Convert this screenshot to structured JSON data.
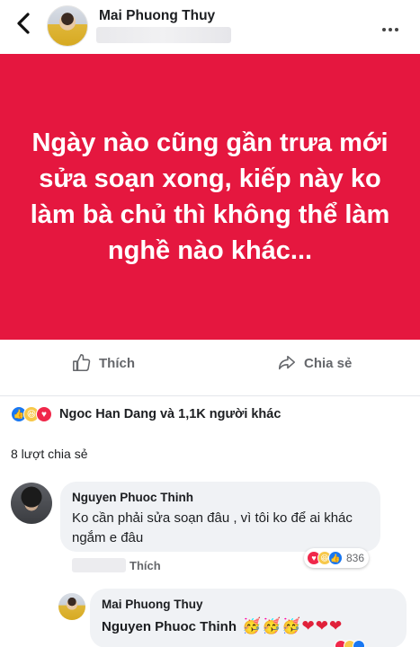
{
  "header": {
    "back_icon": "chevron-left-icon",
    "name": "Mai Phuong Thuy",
    "more_icon": "more-horizontal-icon"
  },
  "post": {
    "text": "Ngày nào cũng gần trưa mới sửa soạn xong, kiếp này ko làm bà chủ thì không thể làm nghề nào khác...",
    "background_color": "#e5173f"
  },
  "actions": {
    "like_label": "Thích",
    "share_label": "Chia sẻ"
  },
  "reactions": {
    "summary": "Ngoc Han Dang và 1,1K người khác",
    "icons": [
      "like-reaction-icon",
      "haha-reaction-icon",
      "love-reaction-icon"
    ]
  },
  "shares_text": "8 lượt chia sẻ",
  "comments": [
    {
      "author": "Nguyen Phuoc Thinh",
      "text": "Ko cần phải sửa soạn đâu , vì tôi ko để ai khác ngắm e đâu",
      "like_label": "Thích",
      "reaction_count": "836"
    }
  ],
  "reply": {
    "author": "Mai Phuong Thuy",
    "mention": "Nguyen Phuoc Thinh",
    "emojis": [
      "🥳",
      "🥳",
      "🥳",
      "❤",
      "❤",
      "❤"
    ]
  }
}
